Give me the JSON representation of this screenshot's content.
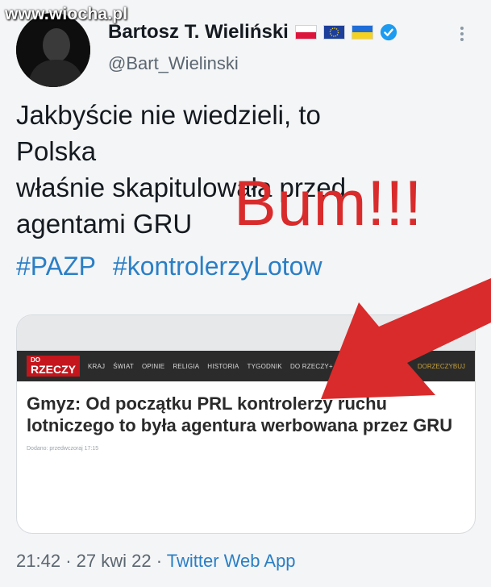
{
  "watermark": "www.wiocha.pl",
  "author": {
    "name": "Bartosz T. Wieliński",
    "handle": "@Bart_Wielinski",
    "flags": [
      "flag-poland-icon",
      "flag-eu-icon",
      "flag-ukraine-icon"
    ],
    "verified_icon": "verified-badge-icon"
  },
  "tweet": {
    "lines": [
      "Jakbyście nie wiedzieli, to Polska",
      "właśnie skapitulowała przed",
      "agentami GRU"
    ],
    "hashtags": [
      "#PAZP",
      "#kontrolerzyLotow"
    ]
  },
  "overlay": {
    "text": "Bum!!!",
    "color": "#d92b2b"
  },
  "card": {
    "logo_top": "DO",
    "logo_main": "RZECZY",
    "nav": [
      "KRAJ",
      "ŚWIAT",
      "OPINIE",
      "RELIGIA",
      "HISTORIA",
      "TYGODNIK",
      "DO RZECZY+"
    ],
    "nav_right": "DORZECZYBUJ",
    "headline": "Gmyz: Od początku PRL kontrolerzy ruchu lotniczego to była agentura werbowana przez GRU",
    "published": "Dodano: przedwczoraj 17:15"
  },
  "footer": {
    "time": "21:42",
    "date": "27 kwi 22",
    "app": "Twitter Web App"
  },
  "colors": {
    "link": "#2a7fc6",
    "arrow": "#d92b2b"
  }
}
